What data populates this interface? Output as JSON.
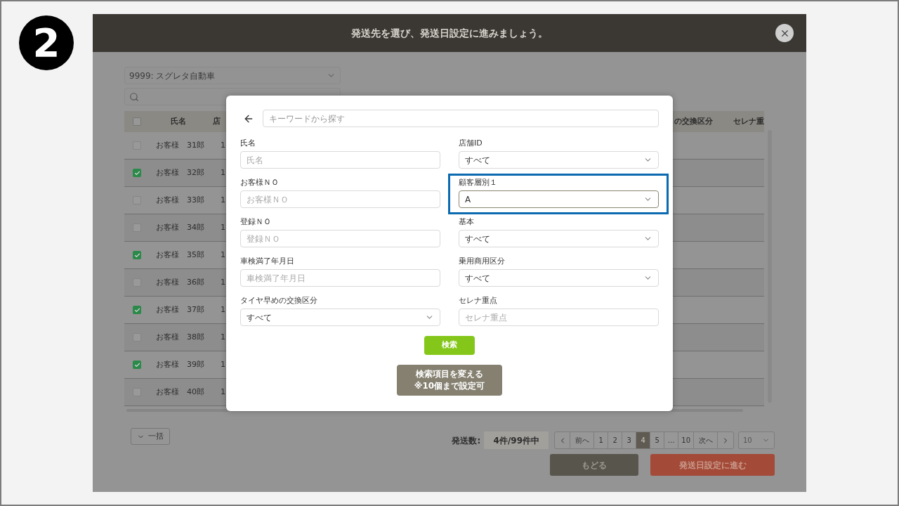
{
  "step_badge": "2",
  "dialog": {
    "title": "発送先を選び、発送日設定に進みましょう。"
  },
  "company_select": {
    "value": "9999: スグレタ自動車"
  },
  "table": {
    "columns": [
      "氏名",
      "店",
      "の交換区分",
      "セレナ重"
    ],
    "header_checked": false,
    "rows": [
      {
        "name": "お客様　31郎",
        "column_2": "1",
        "checked": false
      },
      {
        "name": "お客様　32郎",
        "column_2": "1",
        "checked": true
      },
      {
        "name": "お客様　33郎",
        "column_2": "1",
        "checked": false
      },
      {
        "name": "お客様　34郎",
        "column_2": "1",
        "checked": false
      },
      {
        "name": "お客様　35郎",
        "column_2": "1",
        "checked": true
      },
      {
        "name": "お客様　36郎",
        "column_2": "1",
        "checked": false
      },
      {
        "name": "お客様　37郎",
        "column_2": "1",
        "checked": true
      },
      {
        "name": "お客様　38郎",
        "column_2": "1",
        "checked": false
      },
      {
        "name": "お客様　39郎",
        "column_2": "1",
        "checked": true
      },
      {
        "name": "お客様　40郎",
        "column_2": "1",
        "checked": false
      }
    ]
  },
  "bulk_button": "一括",
  "send_count": {
    "label": "発送数:",
    "value": "4件/99件中"
  },
  "pagination": {
    "prev": "前へ",
    "next": "次へ",
    "per_page": "10",
    "pages": [
      {
        "label": "1",
        "selected": false
      },
      {
        "label": "2",
        "selected": false
      },
      {
        "label": "3",
        "selected": false
      },
      {
        "label": "4",
        "selected": true
      },
      {
        "label": "5",
        "selected": false
      },
      {
        "label": "…",
        "selected": false
      },
      {
        "label": "10",
        "selected": false
      }
    ]
  },
  "buttons": {
    "back": "もどる",
    "next": "発送日設定に進む"
  },
  "search_modal": {
    "keyword_placeholder": "キーワードから探す",
    "fields": [
      {
        "label": "氏名",
        "kind": "text",
        "placeholder": "氏名",
        "highlighted": false
      },
      {
        "label": "店舗ID",
        "kind": "select",
        "value": "すべて",
        "highlighted": false
      },
      {
        "label": "お客様ＮＯ",
        "kind": "text",
        "placeholder": "お客様ＮＯ",
        "highlighted": false
      },
      {
        "label": "顧客層別１",
        "kind": "select",
        "value": "A",
        "highlighted": true
      },
      {
        "label": "登録ＮＯ",
        "kind": "text",
        "placeholder": "登録ＮＯ",
        "highlighted": false
      },
      {
        "label": "基本",
        "kind": "select",
        "value": "すべて",
        "highlighted": false
      },
      {
        "label": "車検満了年月日",
        "kind": "text",
        "placeholder": "車検満了年月日",
        "highlighted": false
      },
      {
        "label": "乗用商用区分",
        "kind": "select",
        "value": "すべて",
        "highlighted": false
      },
      {
        "label": "タイヤ早めの交換区分",
        "kind": "select",
        "value": "すべて",
        "highlighted": false
      },
      {
        "label": "セレナ重点",
        "kind": "text",
        "placeholder": "セレナ重点",
        "highlighted": false
      }
    ],
    "search_button": "検索",
    "change_button": [
      "検索項目を変える",
      "※10個まで設定可"
    ]
  }
}
